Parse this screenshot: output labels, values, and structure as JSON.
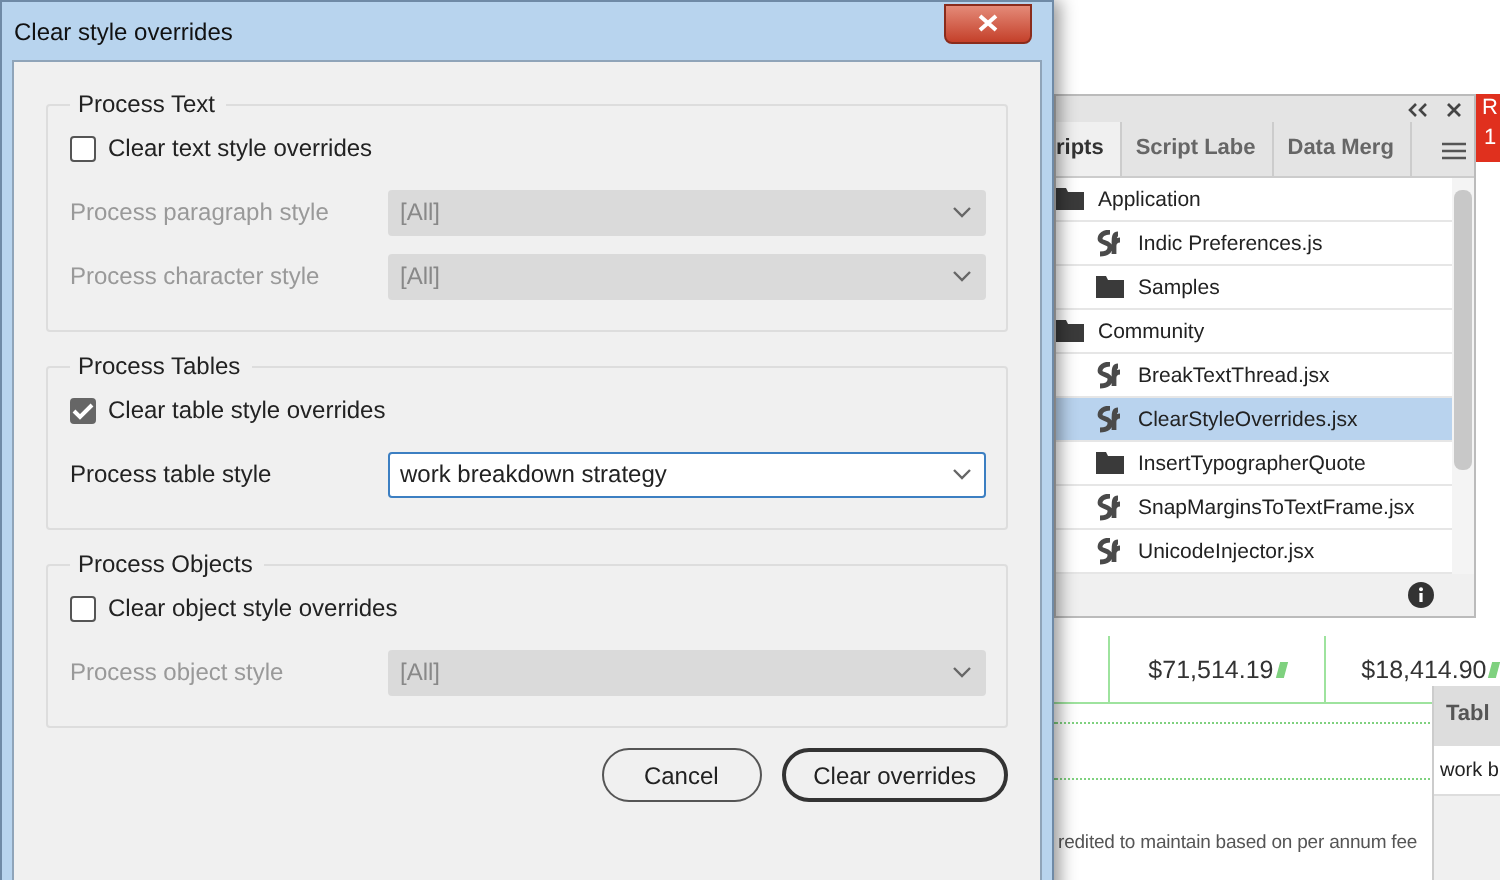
{
  "dialog": {
    "title": "Clear style overrides",
    "groups": [
      {
        "title": "Process Text",
        "checkbox": {
          "label": "Clear text style overrides",
          "checked": false
        },
        "selects": [
          {
            "label": "Process paragraph style",
            "value": "[All]",
            "disabled": true
          },
          {
            "label": "Process character style",
            "value": "[All]",
            "disabled": true
          }
        ]
      },
      {
        "title": "Process Tables",
        "checkbox": {
          "label": "Clear table style overrides",
          "checked": true
        },
        "selects": [
          {
            "label": "Process table style",
            "value": "work breakdown strategy",
            "disabled": false
          }
        ]
      },
      {
        "title": "Process Objects",
        "checkbox": {
          "label": "Clear object style overrides",
          "checked": false
        },
        "selects": [
          {
            "label": "Process object style",
            "value": "[All]",
            "disabled": true
          }
        ]
      }
    ],
    "buttons": [
      {
        "label": "Cancel",
        "default": false
      },
      {
        "label": "Clear overrides",
        "default": true
      }
    ]
  },
  "scripts_panel": {
    "tabs": [
      {
        "label": "ripts",
        "selected": true
      },
      {
        "label": "Script Labe",
        "selected": false
      },
      {
        "label": "Data Merg",
        "selected": false
      }
    ],
    "items": [
      {
        "kind": "folder",
        "label": "Application",
        "selected": false,
        "children": [
          {
            "kind": "script",
            "label": "Indic Preferences.js",
            "selected": false
          },
          {
            "kind": "folder",
            "label": "Samples",
            "selected": false
          }
        ]
      },
      {
        "kind": "folder",
        "label": "Community",
        "selected": false,
        "children": [
          {
            "kind": "script",
            "label": "BreakTextThread.jsx",
            "selected": false
          },
          {
            "kind": "script",
            "label": "ClearStyleOverrides.jsx",
            "selected": true
          },
          {
            "kind": "folder",
            "label": "InsertTypographerQuote",
            "selected": false
          },
          {
            "kind": "script",
            "label": "SnapMarginsToTextFrame.jsx",
            "selected": false
          },
          {
            "kind": "script",
            "label": "UnicodeInjector.jsx",
            "selected": false
          }
        ]
      }
    ]
  },
  "document": {
    "badge": [
      "R",
      "1"
    ],
    "cells": [
      "$71,514.19",
      "$18,414.90"
    ],
    "footnote": "redited to maintain based on per annum fee"
  },
  "table_panel": {
    "title": "Tabl",
    "value": "work b"
  }
}
